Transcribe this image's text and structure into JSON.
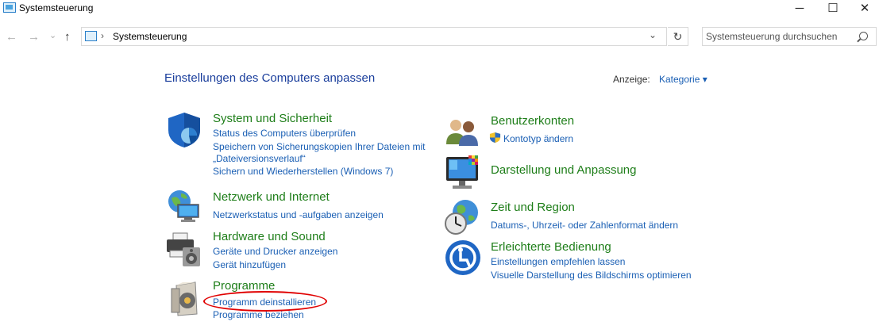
{
  "window": {
    "title": "Systemsteuerung",
    "minimize": "─",
    "maximize": "☐",
    "close": "✕"
  },
  "addressbar": {
    "back": "←",
    "forward": "→",
    "recent": "⌄",
    "up": "↑",
    "separator": "›",
    "path": "Systemsteuerung",
    "dropdown": "⌄",
    "refresh": "↻"
  },
  "search": {
    "placeholder": "Systemsteuerung durchsuchen"
  },
  "page": {
    "heading": "Einstellungen des Computers anpassen",
    "view_label": "Anzeige:",
    "view_value": "Kategorie ▾"
  },
  "categories": {
    "system": {
      "title": "System und Sicherheit",
      "icon": "shield-icon",
      "links": [
        "Status des Computers überprüfen",
        "Speichern von Sicherungskopien Ihrer Dateien mit",
        "„Dateiversionsverlauf“",
        "Sichern und Wiederherstellen (Windows 7)"
      ]
    },
    "network": {
      "title": "Netzwerk und Internet",
      "icon": "network-globe-icon",
      "links": [
        "Netzwerkstatus und -aufgaben anzeigen"
      ]
    },
    "hardware": {
      "title": "Hardware und Sound",
      "icon": "printer-speaker-icon",
      "links": [
        "Geräte und Drucker anzeigen",
        "Gerät hinzufügen"
      ]
    },
    "programs": {
      "title": "Programme",
      "icon": "programs-disc-icon",
      "links": [
        "Programm deinstallieren",
        "Programme beziehen"
      ]
    },
    "users": {
      "title": "Benutzerkonten",
      "icon": "users-icon",
      "links": [
        "Kontotyp ändern"
      ]
    },
    "appearance": {
      "title": "Darstellung und Anpassung",
      "icon": "monitor-palette-icon",
      "links": []
    },
    "clock": {
      "title": "Zeit und Region",
      "icon": "clock-globe-icon",
      "links": [
        "Datums-, Uhrzeit- oder Zahlenformat ändern"
      ]
    },
    "access": {
      "title": "Erleichterte Bedienung",
      "icon": "accessibility-icon",
      "links": [
        "Einstellungen empfehlen lassen",
        "Visuelle Darstellung des Bildschirms optimieren"
      ]
    }
  },
  "colors": {
    "category_title": "#1e7e19",
    "link": "#1a5fb4",
    "heading": "#1a3e9c",
    "highlight": "#e00000"
  }
}
